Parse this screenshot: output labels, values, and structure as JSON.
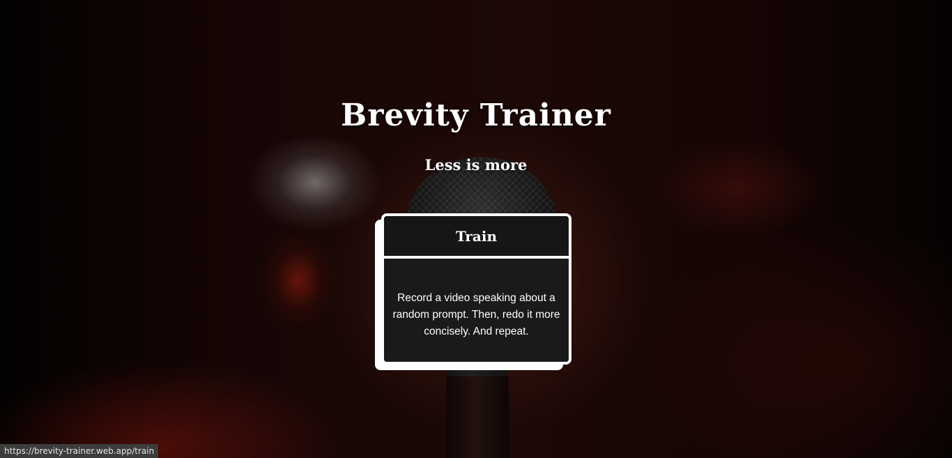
{
  "header": {
    "title": "Brevity Trainer",
    "subtitle": "Less is more"
  },
  "card": {
    "title": "Train",
    "description": "Record a video speaking about a random prompt. Then, redo it more concisely. And repeat."
  },
  "status_bar": {
    "url": "https://brevity-trainer.web.app/train"
  },
  "colors": {
    "text": "#ffffff",
    "card_border": "#ffffff",
    "card_body": "#1a1a1a",
    "background": "#1c0807"
  }
}
